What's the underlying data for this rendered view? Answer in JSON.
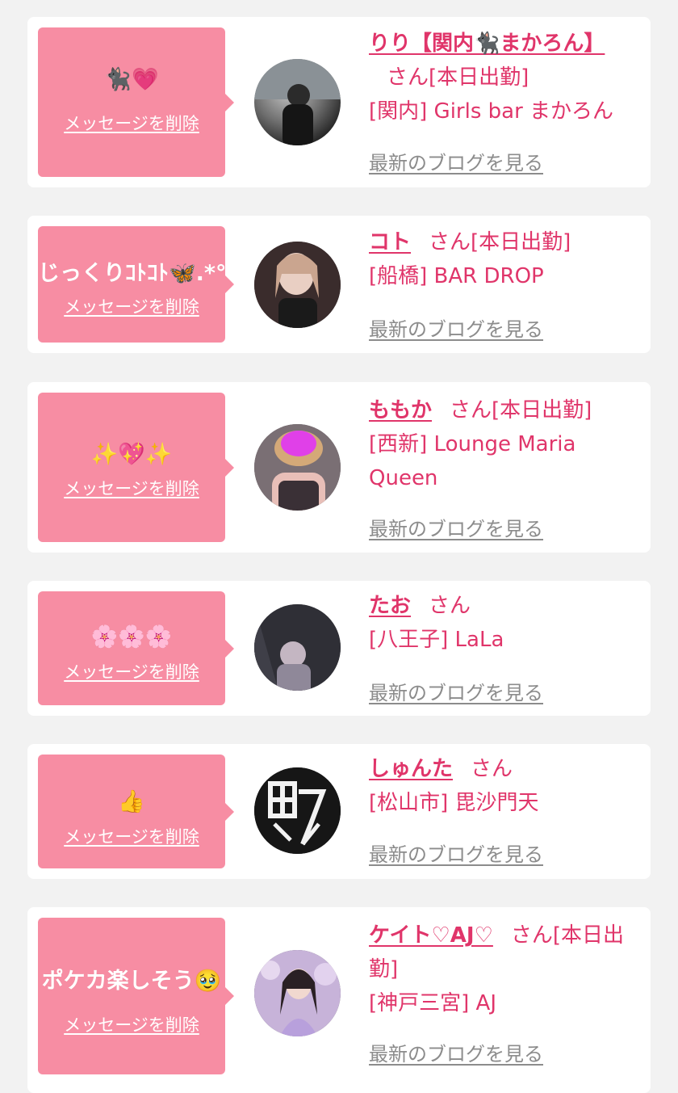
{
  "colors": {
    "accent": "#e0356a",
    "bubble": "#f78da3",
    "background": "#f2f2f2"
  },
  "delete_label": "メッセージを削除",
  "blog_label": "最新のブログを見る",
  "messages": [
    {
      "message": "🐈‍⬛💗",
      "name": "りり【関内🐈‍⬛まかろん】",
      "suffix": "さん[本日出勤]",
      "shop": "[関内] Girls bar まかろん",
      "avatar": "woman-photo"
    },
    {
      "message": "じっくりｺﾄｺﾄ🦋.*°",
      "name": "コト",
      "suffix": "さん[本日出勤]",
      "shop": "[船橋] BAR DROP",
      "avatar": "woman-photo"
    },
    {
      "message": "✨💖✨",
      "name": "ももか",
      "suffix": "さん[本日出勤]",
      "shop": "[西新] Lounge Maria Queen",
      "avatar": "woman-photo"
    },
    {
      "message": "🌸🌸🌸",
      "name": "たお",
      "suffix": "さん",
      "shop": "[八王子] LaLa",
      "avatar": "woman-photo"
    },
    {
      "message": "👍",
      "name": "しゅんた",
      "suffix": "さん",
      "shop": "[松山市] 毘沙門天",
      "avatar": "bishamonten-logo"
    },
    {
      "message": "ポケカ楽しそう🥹",
      "name": "ケイト♡AJ♡",
      "suffix": "さん[本日出勤]",
      "shop": "[神戸三宮] AJ",
      "avatar": "woman-photo"
    }
  ]
}
